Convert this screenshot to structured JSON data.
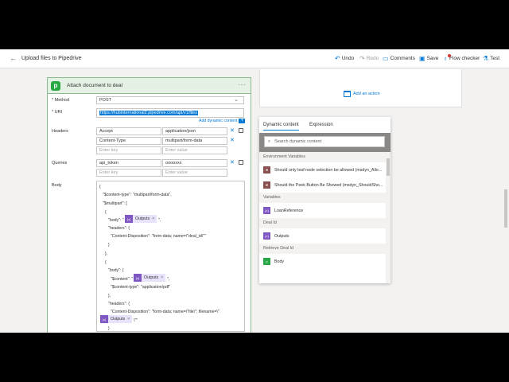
{
  "header": {
    "back_icon": "back-arrow-icon",
    "title": "Upload files to Pipedrive",
    "undo": "Undo",
    "redo": "Redo",
    "comments": "Comments",
    "save": "Save",
    "flow_checker": "Flow checker",
    "test": "Test"
  },
  "right_card": {
    "add_action": "Add an action"
  },
  "action": {
    "title": "Attach document to deal",
    "more": "···",
    "method_label": "* Method",
    "method_value": "POST",
    "uri_label": "* URI",
    "uri_value": "https://hubinternational2.pipedrive.com/api/v1/files",
    "add_dynamic": "Add dynamic content",
    "headers_label": "Headers",
    "headers": [
      {
        "key": "Accept",
        "value": "application/json"
      },
      {
        "key": "Content-Type",
        "value": "multipart/form-data"
      }
    ],
    "key_placeholder": "Enter key",
    "value_placeholder": "Enter value",
    "queries_label": "Queries",
    "query": {
      "key": "api_token",
      "value": "ooooxxx"
    },
    "body_label": "Body",
    "body_lines": [
      "{",
      "\"$content-type\": \"multipart/form-data\",",
      "\"$multipart\": [",
      "{",
      "\"body\": \"",
      "\",",
      "\"headers\": {",
      "\"Content-Disposition\": \"form-data; name=\\\"deal_id\\\"\"",
      "}",
      "},",
      "{",
      "\"body\": {",
      "\"$content\": \"",
      "\",",
      "\"$content-type\": \"application/pdf\"",
      "},",
      "\"headers\": {",
      "\"Content-Disposition\": \"form-data; name=\\\"file\\\"; filename=\\\"",
      "\\\"\"",
      "}"
    ],
    "token_label": "Outputs",
    "token_close": "×"
  },
  "dynamic": {
    "tab_dynamic": "Dynamic content",
    "tab_expression": "Expression",
    "search_placeholder": "Search dynamic content",
    "sections": [
      {
        "title": "Environment Variables",
        "items": [
          "Should only leaf node selection be allowed (msdyn_Allo...",
          "Should the Peek Button Be Showed (msdyn_ShouldSho..."
        ]
      },
      {
        "title": "Variables",
        "items": [
          "LoanReference"
        ]
      },
      {
        "title": "Deal Id",
        "items": [
          "Outputs"
        ]
      },
      {
        "title": "Retrieve Deal Id",
        "items": [
          "Body"
        ]
      }
    ]
  },
  "colors": {
    "accent": "#0078d4",
    "card_border": "#8cbd8c",
    "card_header": "#e5f1e5",
    "token_bg": "#e8e2fa",
    "token_icon": "#7e57c2"
  }
}
